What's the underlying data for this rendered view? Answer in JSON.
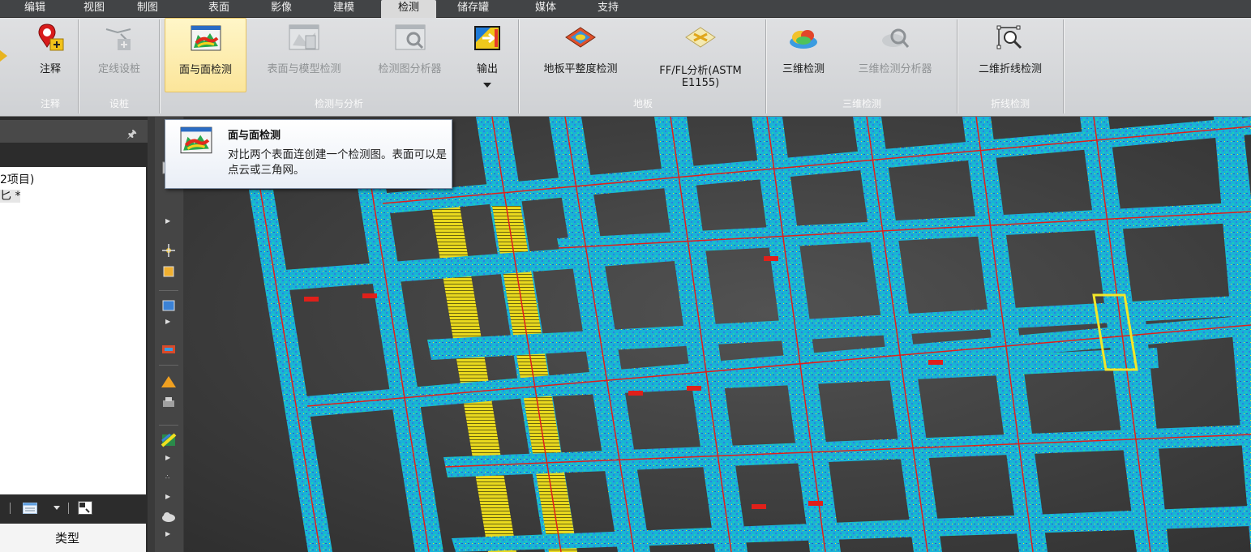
{
  "menu": {
    "items": [
      {
        "label": "编辑"
      },
      {
        "label": "视图"
      },
      {
        "label": "制图"
      },
      {
        "label": "表面"
      },
      {
        "label": "影像"
      },
      {
        "label": "建模"
      },
      {
        "label": "检测"
      },
      {
        "label": "储存罐"
      },
      {
        "label": "媒体"
      },
      {
        "label": "支持"
      }
    ],
    "active": "检测"
  },
  "ribbon": {
    "buttons": {
      "annotate": "注释",
      "stake_line": "定线设桩",
      "surface_to_surface": "面与面检测",
      "surface_to_model": "表面与模型检测",
      "inspection_map_analyzer": "检测图分析器",
      "output": "输出",
      "floor_flatness": "地板平整度检测",
      "ff_fl_line1": "FF/FL分析(ASTM",
      "ff_fl_line2": "E1155)",
      "inspect_3d": "三维检测",
      "inspect_3d_analyzer": "三维检测分析器",
      "inspect_2d_polyline": "二维折线检测"
    },
    "groups": {
      "annotate": "注释",
      "stake": "设桩",
      "inspect_analyze": "检测与分析",
      "floor": "地板",
      "inspect_3d": "三维检测",
      "polyline": "折线检测"
    }
  },
  "tooltip": {
    "title": "面与面检测",
    "description": "对比两个表面连创建一个检测图。表面可以是点云或三角网。"
  },
  "left_panel": {
    "tree_line1": "2项目)",
    "tree_line2": "匕 *",
    "props_type_header": "类型"
  },
  "colors": {
    "accent_hover": "#fbe59a",
    "rebar_cyan": "#19b3d6",
    "rebar_yellow": "#f2e629",
    "rebar_red": "#e0201a"
  }
}
